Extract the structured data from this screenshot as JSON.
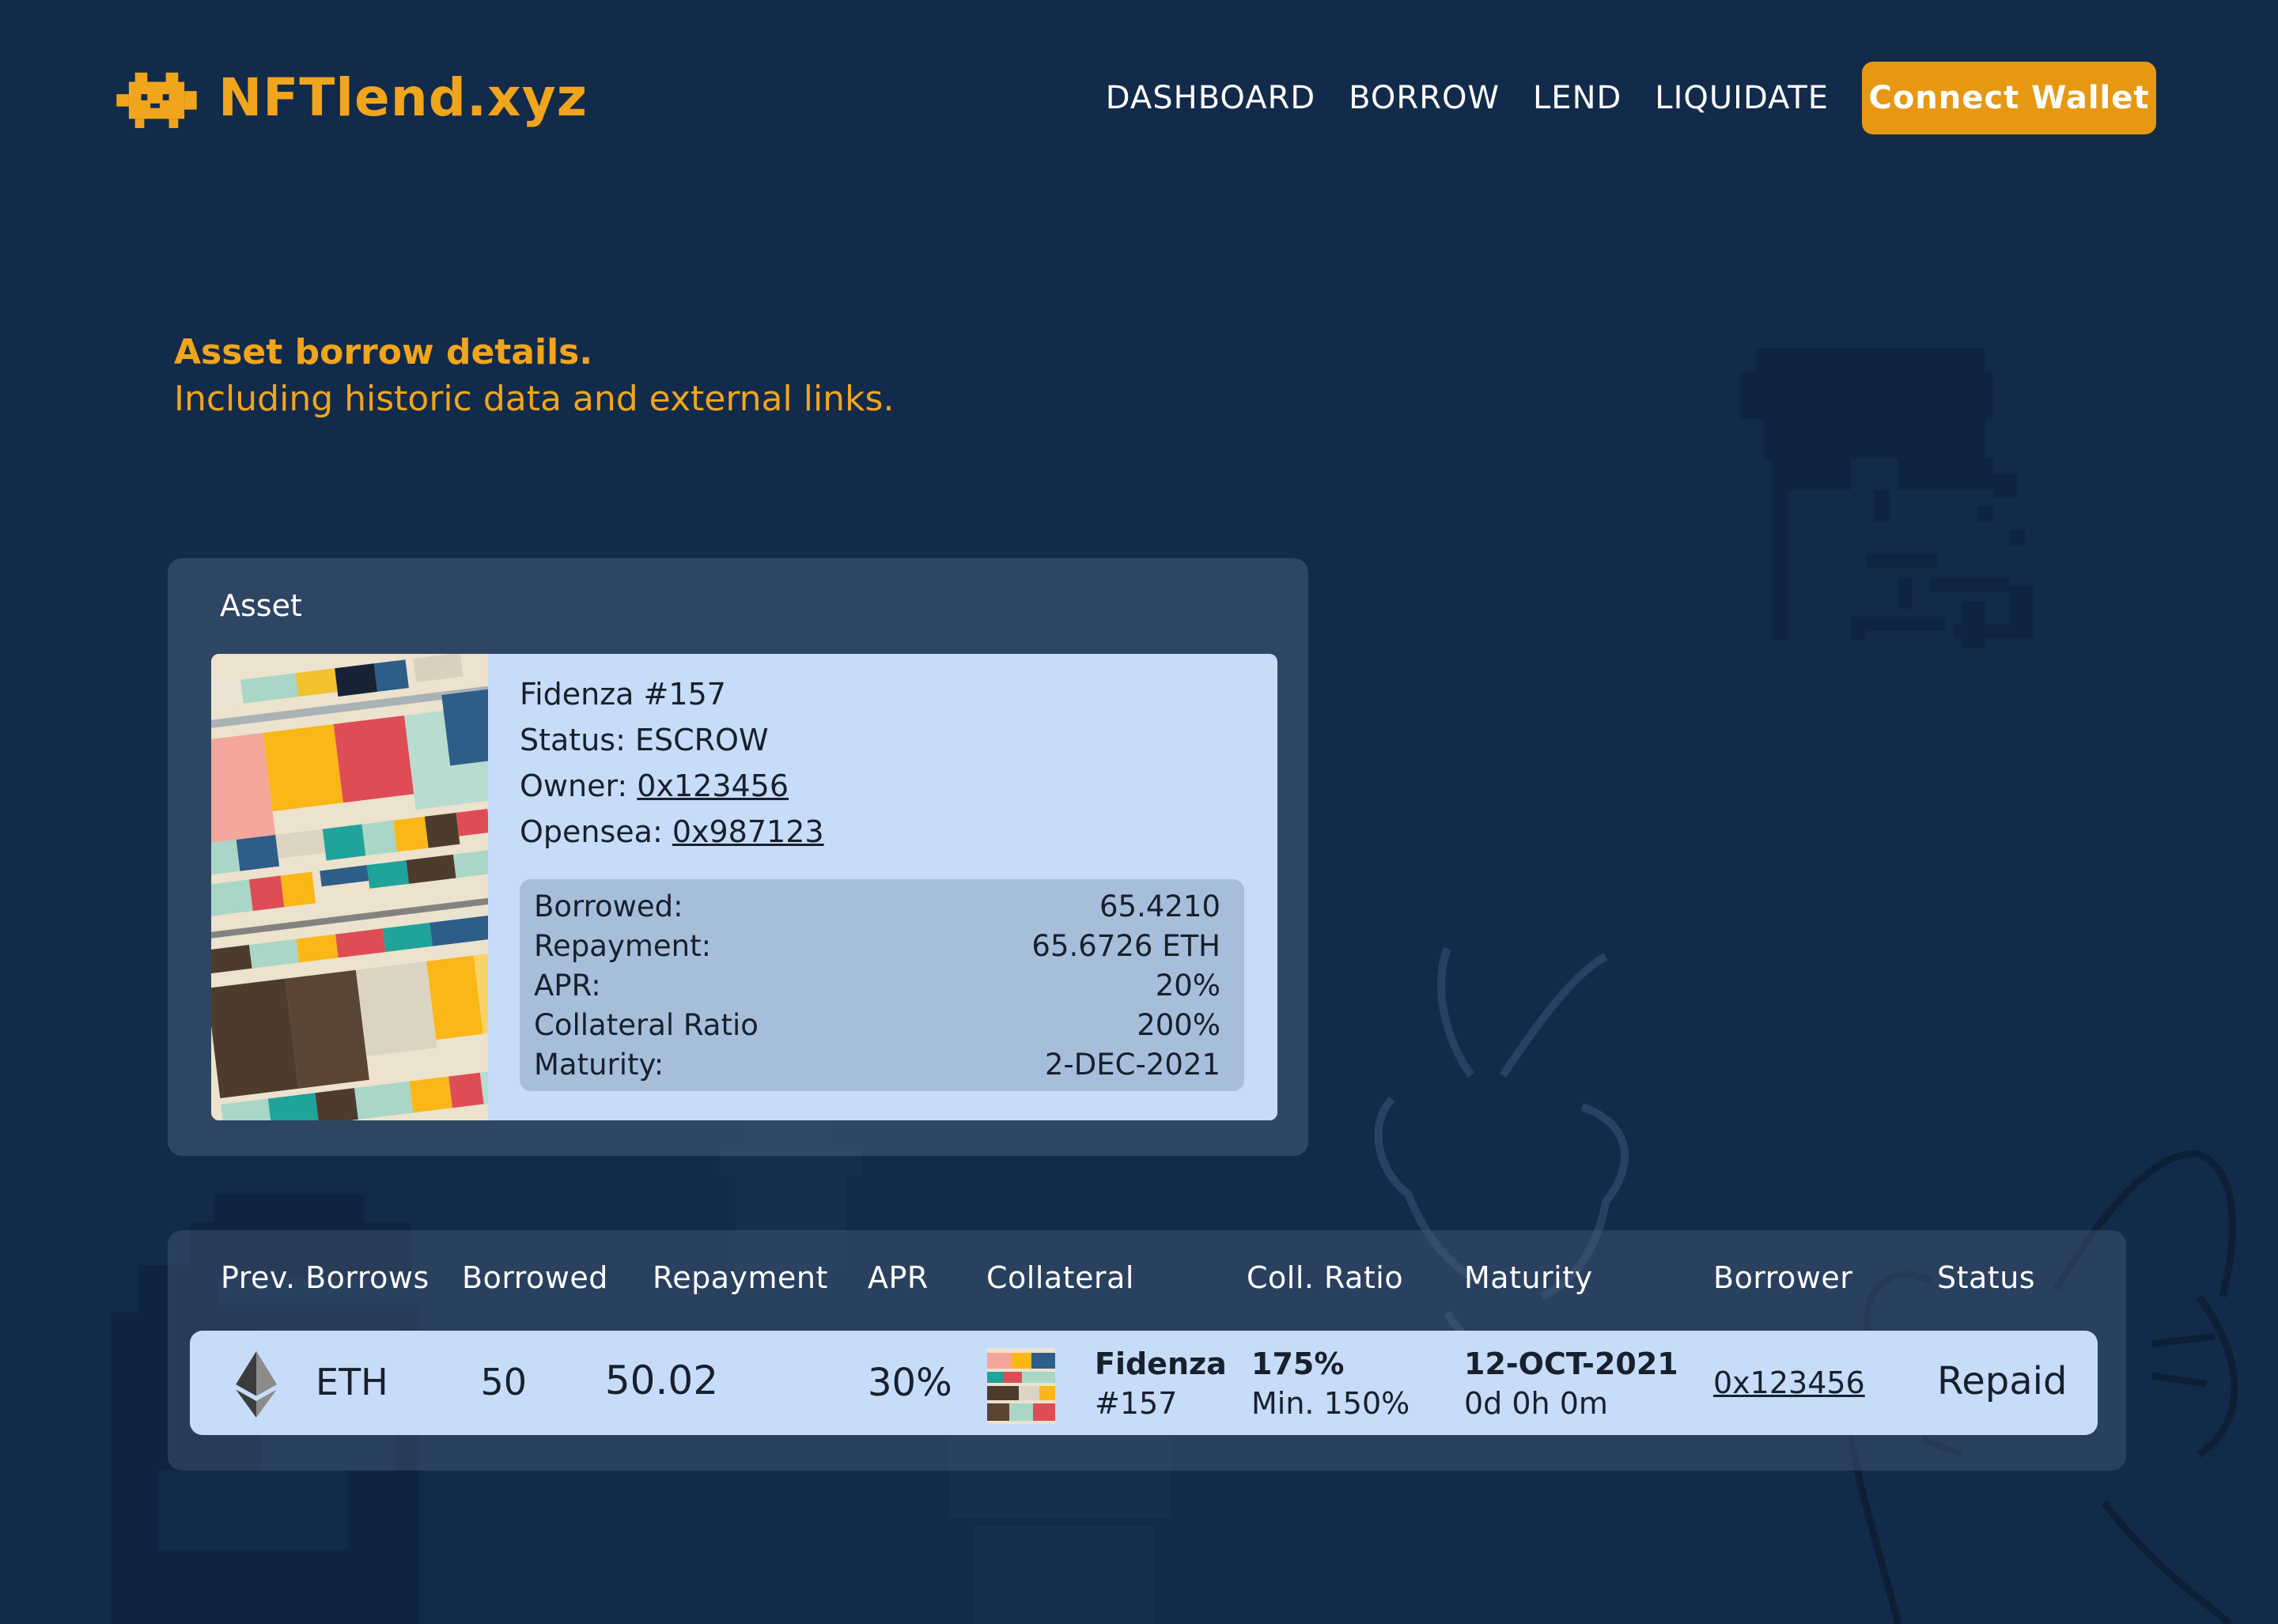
{
  "brand": {
    "name": "NFTlend.xyz"
  },
  "nav": {
    "items": [
      "DASHBOARD",
      "BORROW",
      "LEND",
      "LIQUIDATE"
    ],
    "connect": "Connect Wallet"
  },
  "headline": {
    "title": "Asset borrow details.",
    "subtitle": "Including historic data and external links."
  },
  "asset": {
    "section_label": "Asset",
    "name": "Fidenza #157",
    "status_label": "Status: ",
    "status": "ESCROW",
    "owner_label": "Owner: ",
    "owner": "0x123456",
    "opensea_label": "Opensea: ",
    "opensea": "0x987123",
    "stats": [
      {
        "label": "Borrowed:",
        "value": "65.4210"
      },
      {
        "label": "Repayment:",
        "value": "65.6726 ETH"
      },
      {
        "label": "APR:",
        "value": "20%"
      },
      {
        "label": "Collateral Ratio",
        "value": "200%"
      },
      {
        "label": "Maturity:",
        "value": "2-DEC-2021"
      }
    ]
  },
  "prev_borrows": {
    "headers": [
      "Prev. Borrows",
      "Borrowed",
      "Repayment",
      "APR",
      "Collateral",
      "Coll. Ratio",
      "Maturity",
      "Borrower",
      "Status"
    ],
    "rows": [
      {
        "currency": "ETH",
        "borrowed": "50",
        "repayment": "50.02",
        "apr": "30%",
        "collateral_name": "Fidenza",
        "collateral_id": "#157",
        "coll_ratio": "175%",
        "coll_min": "Min. 150%",
        "maturity": "12-OCT-2021",
        "maturity_left": "0d 0h 0m",
        "borrower": "0x123456",
        "status": "Repaid"
      }
    ]
  },
  "colors": {
    "background": "#132b4a",
    "accent": "#f0a51c",
    "button": "#e69812",
    "card": "#c7dcf8",
    "stats_box": "#a7bedb"
  },
  "icons": [
    "logo-cat-icon",
    "ethereum-icon"
  ]
}
